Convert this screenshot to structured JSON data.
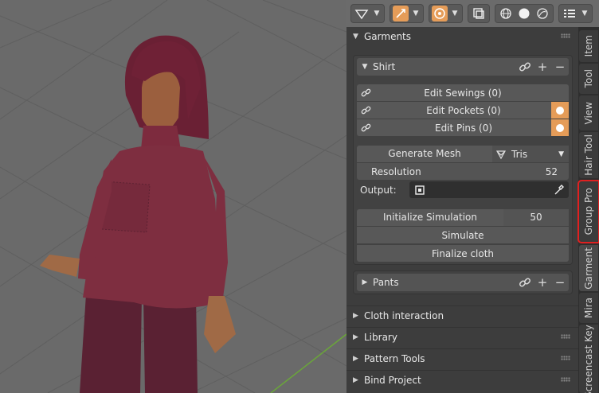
{
  "header": {
    "icons": [
      "transform-gizmo-icon",
      "snap-icon",
      "proportional-icon",
      "overlay-icon",
      "shading-wire-icon",
      "shading-solid-icon",
      "shading-material-icon",
      "menu-list-icon"
    ],
    "accent": "#e59c58"
  },
  "panel": {
    "title": "Garments",
    "shirt": {
      "name": "Shirt",
      "edit_sewings": "Edit Sewings (0)",
      "edit_pockets": "Edit Pockets (0)",
      "edit_pins": "Edit Pins (0)",
      "generate_mesh": "Generate Mesh",
      "mesh_type": "Tris",
      "resolution_label": "Resolution",
      "resolution_value": "52",
      "output_label": "Output:",
      "init_sim": "Initialize Simulation",
      "init_sim_value": "50",
      "simulate": "Simulate",
      "finalize": "Finalize cloth"
    },
    "pants": {
      "name": "Pants"
    },
    "sections": [
      "Cloth interaction",
      "Library",
      "Pattern Tools",
      "Bind Project"
    ]
  },
  "tabs": [
    "Item",
    "Tool",
    "View",
    "Hair Tool",
    "Group Pro",
    "Garment",
    "Mira",
    "Screencast Keys"
  ]
}
